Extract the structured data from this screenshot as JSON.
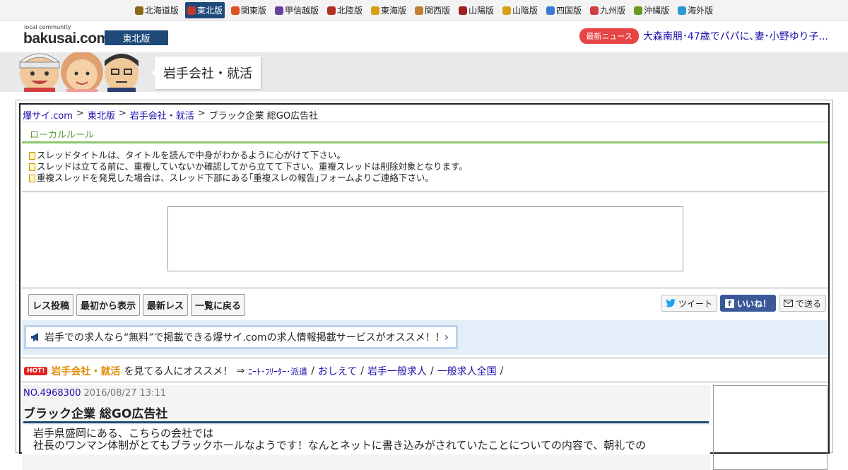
{
  "regions": [
    {
      "label": "北海道版",
      "icon": "hokkaido-icon",
      "color": "#8b6914"
    },
    {
      "label": "東北版",
      "icon": "tohoku-icon",
      "color": "#c0392b",
      "active": true
    },
    {
      "label": "関東版",
      "icon": "kanto-tower-icon",
      "color": "#e05020"
    },
    {
      "label": "甲信越版",
      "icon": "grape-icon",
      "color": "#6a3fa0"
    },
    {
      "label": "北陸版",
      "icon": "torii-icon",
      "color": "#b03020"
    },
    {
      "label": "東海版",
      "icon": "shachihoko-icon",
      "color": "#d4a017"
    },
    {
      "label": "関西版",
      "icon": "takoyaki-icon",
      "color": "#c08030"
    },
    {
      "label": "山陽版",
      "icon": "castle-icon",
      "color": "#a02020"
    },
    {
      "label": "山陰版",
      "icon": "crab-icon",
      "color": "#d4a017"
    },
    {
      "label": "四国版",
      "icon": "udon-icon",
      "color": "#3a7bd5"
    },
    {
      "label": "九州版",
      "icon": "mentaiko-icon",
      "color": "#d04040"
    },
    {
      "label": "沖縄版",
      "icon": "shisa-icon",
      "color": "#6a9a20"
    },
    {
      "label": "海外版",
      "icon": "globe-icon",
      "color": "#2a9ad0"
    }
  ],
  "header": {
    "logo_small": "local community",
    "logo": "bakusai.com",
    "edition": "東北版",
    "news_badge": "最新ニュース",
    "news_headline": "大森南朋･47歳でパパに､妻･小野ゆり子..."
  },
  "banner": {
    "title": "岩手会社・就活"
  },
  "breadcrumb": [
    "爆サイ.com",
    "東北版",
    "岩手会社・就活",
    "ブラック企業 総GO広告社"
  ],
  "local_rule": {
    "title": "ローカルルール",
    "rules": [
      "スレッドタイトルは、タイトルを読んで中身がわかるように心がけて下さい。",
      "スレッドは立てる前に、重複していないか確認してから立てて下さい。重複スレッドは削除対象となります。",
      "重複スレッドを発見した場合は、スレッド下部にある｢重複スレの報告｣フォームよりご連絡下さい。"
    ]
  },
  "buttons": [
    "レス投稿",
    "最初から表示",
    "最新レス",
    "一覧に戻る"
  ],
  "share": {
    "tweet": "ツイート",
    "like": "いいね！",
    "send": "で送る"
  },
  "promo": "岩手での求人なら“無料”で掲載できる爆サイ.comの求人情報掲載サービスがオススメ！！",
  "recommend": {
    "hot": "HOT!",
    "category": "岩手会社・就活",
    "text": "を見てる人にオススメ！",
    "arrow": "⇒",
    "links": [
      "ﾆｰﾄ･ﾌﾘｰﾀｰ･派遣",
      "おしえて",
      "岩手一般求人",
      "一般求人全国"
    ]
  },
  "post": {
    "number": "NO.4968300",
    "date": "2016/08/27 13:11",
    "title": "ブラック企業 総GO広告社",
    "body_line1": "岩手県盛岡にある、こちらの会社では",
    "body_line2": "社長のワンマン体制がとてもブラックホールなようです！なんとネットに書き込みがされていたことについての内容で、朝礼での"
  }
}
